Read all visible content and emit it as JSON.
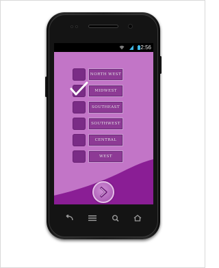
{
  "status_bar": {
    "time": "2:56",
    "icons": [
      "wifi-icon",
      "signal-icon",
      "battery-icon"
    ]
  },
  "colors": {
    "screen_background": "#c275c7",
    "wave": "#8a1e95",
    "checkbox": "#7a2c86",
    "label_button": "#8d3a95",
    "check_color": "#ffffff"
  },
  "regions": [
    {
      "label": "NORTH WEST",
      "checked": false
    },
    {
      "label": "MIDWEST",
      "checked": true
    },
    {
      "label": "SOUTHEAST",
      "checked": false
    },
    {
      "label": "SOUTHWEST",
      "checked": false
    },
    {
      "label": "CENTRAL",
      "checked": false
    },
    {
      "label": "WEST",
      "checked": false
    }
  ],
  "next_button": {
    "icon": "chevron-right-icon"
  },
  "nav_keys": [
    "back-icon",
    "menu-icon",
    "search-icon",
    "home-icon"
  ]
}
